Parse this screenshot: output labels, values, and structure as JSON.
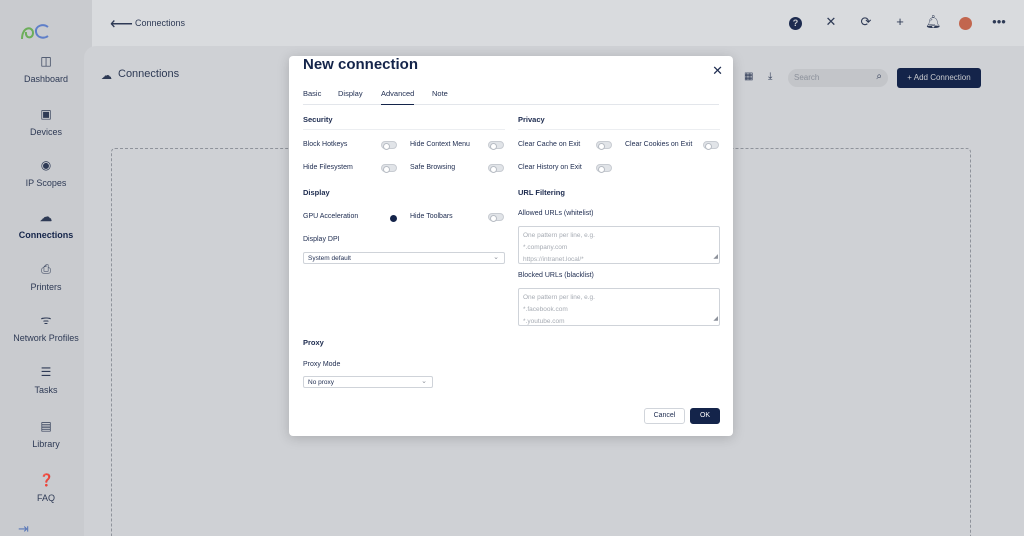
{
  "app": {
    "logo": "logo-icon",
    "sidebar": {
      "items": [
        {
          "label": "Dashboard",
          "icon": "dashboard-icon",
          "active": false
        },
        {
          "label": "Devices",
          "icon": "devices-icon",
          "active": false
        },
        {
          "label": "IP Scopes",
          "icon": "ip-scopes-icon",
          "active": false
        },
        {
          "label": "Connections",
          "icon": "connections-icon",
          "active": true
        },
        {
          "label": "Printers",
          "icon": "printer-icon",
          "active": false
        },
        {
          "label": "Network Profiles",
          "icon": "wifi-icon",
          "active": false
        },
        {
          "label": "Tasks",
          "icon": "tasks-icon",
          "active": false
        },
        {
          "label": "Library",
          "icon": "library-icon",
          "active": false
        },
        {
          "label": "FAQ",
          "icon": "faq-icon",
          "active": false
        }
      ]
    },
    "topbar": {
      "title": "Connections",
      "help_glyph": "?"
    },
    "content": {
      "section_title": "Connections",
      "search_placeholder": "Search",
      "add_button": "+ Add Connection"
    }
  },
  "modal": {
    "title": "New connection",
    "tabs": [
      {
        "label": "Basic",
        "active": false
      },
      {
        "label": "Display",
        "active": false
      },
      {
        "label": "Advanced",
        "active": true
      },
      {
        "label": "Note",
        "active": false
      }
    ],
    "security": {
      "heading": "Security",
      "block_hotkeys": {
        "label": "Block Hotkeys",
        "on": false
      },
      "hide_context_menu": {
        "label": "Hide Context Menu",
        "on": false
      },
      "hide_filesystem": {
        "label": "Hide Filesystem",
        "on": false
      },
      "safe_browsing": {
        "label": "Safe Browsing",
        "on": false
      }
    },
    "privacy": {
      "heading": "Privacy",
      "clear_cache": {
        "label": "Clear Cache on Exit",
        "on": false
      },
      "clear_cookies": {
        "label": "Clear Cookies on Exit",
        "on": false
      },
      "clear_history": {
        "label": "Clear History on Exit",
        "on": false
      }
    },
    "display": {
      "heading": "Display",
      "gpu_acceleration": {
        "label": "GPU Acceleration",
        "on": true
      },
      "hide_toolbars": {
        "label": "Hide Toolbars",
        "on": false
      },
      "dpi_label": "Display DPI",
      "dpi_value": "System default"
    },
    "url_filtering": {
      "heading": "URL Filtering",
      "allowed_label": "Allowed URLs (whitelist)",
      "allowed_placeholder": [
        "One pattern per line, e.g.",
        "*.company.com",
        "https://intranet.local/*"
      ],
      "blocked_label": "Blocked URLs (blacklist)",
      "blocked_placeholder": [
        "One pattern per line, e.g.",
        "*.facebook.com",
        "*.youtube.com"
      ]
    },
    "proxy": {
      "heading": "Proxy",
      "mode_label": "Proxy Mode",
      "mode_value": "No proxy"
    },
    "buttons": {
      "cancel": "Cancel",
      "ok": "OK"
    }
  }
}
